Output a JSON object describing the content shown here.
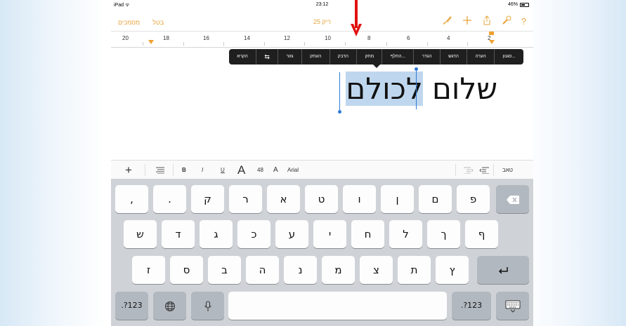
{
  "status": {
    "device": "iPad",
    "time": "23:12",
    "battery": "46%"
  },
  "toolbar": {
    "documents_label": "מסמכים",
    "cancel_label": "בטל",
    "title": "ריק 25"
  },
  "ruler": {
    "labels": [
      "20",
      "18",
      "16",
      "14",
      "12",
      "10",
      "8",
      "6",
      "4",
      "2"
    ]
  },
  "context_menu": {
    "items": [
      "הקרא",
      "⇆",
      "גזור",
      "העתק",
      "הדבק",
      "מחק",
      "החלף...",
      "הגדר",
      "הדגש",
      "הערה",
      "סגנון..."
    ]
  },
  "document": {
    "word1": "שלום",
    "word2": "לכולם"
  },
  "format_bar": {
    "plus": "+",
    "bold": "B",
    "italic": "I",
    "underline": "U",
    "font_big": "A",
    "font_size": "48",
    "font_small": "A",
    "font_name": "Arial",
    "tab_label": "טאב"
  },
  "keyboard": {
    "row1": [
      ",",
      ".",
      "ק",
      "ר",
      "א",
      "ט",
      "ו",
      "ן",
      "ם",
      "פ"
    ],
    "row2": [
      "ש",
      "ד",
      "ג",
      "כ",
      "ע",
      "י",
      "ח",
      "ל",
      "ך",
      "ף"
    ],
    "row3": [
      "ז",
      "ס",
      "ב",
      "ה",
      "נ",
      "מ",
      "צ",
      "ת",
      "ץ"
    ],
    "numbers_label": ".?123",
    "numbers_label_right": ".?123",
    "backspace": "⌫",
    "return": "↵",
    "globe": "🌐",
    "mic": "🎙",
    "hide": "⌨"
  },
  "colors": {
    "accent": "#e7a43c",
    "selection": "#bfd7ee",
    "handle": "#2f7ad6",
    "arrow": "#e0120f"
  }
}
